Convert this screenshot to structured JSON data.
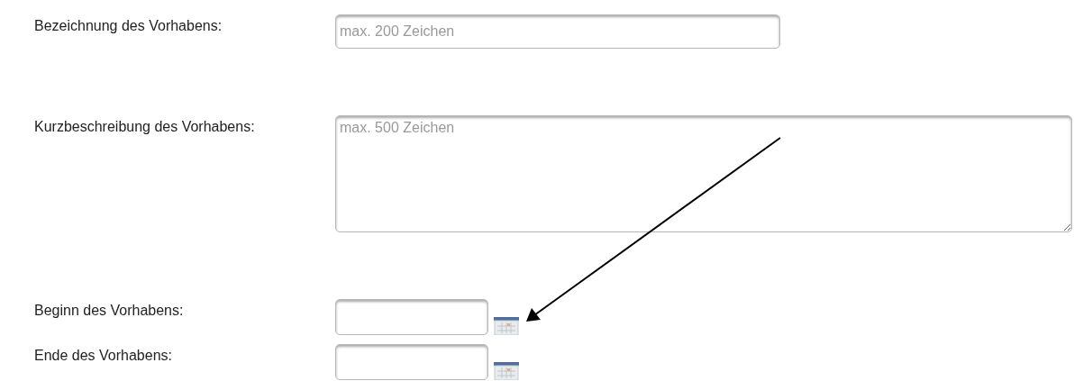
{
  "fields": [
    {
      "kind": "text",
      "label": "Bezeichnung des Vorhabens:",
      "placeholder": "max. 200 Zeichen"
    },
    {
      "kind": "textarea",
      "label": "Kurzbeschreibung des Vorhabens:",
      "placeholder": "max. 500 Zeichen"
    },
    {
      "kind": "date",
      "label": "Beginn des Vorhabens:"
    },
    {
      "kind": "date",
      "label": "Ende des Vorhabens:"
    }
  ]
}
